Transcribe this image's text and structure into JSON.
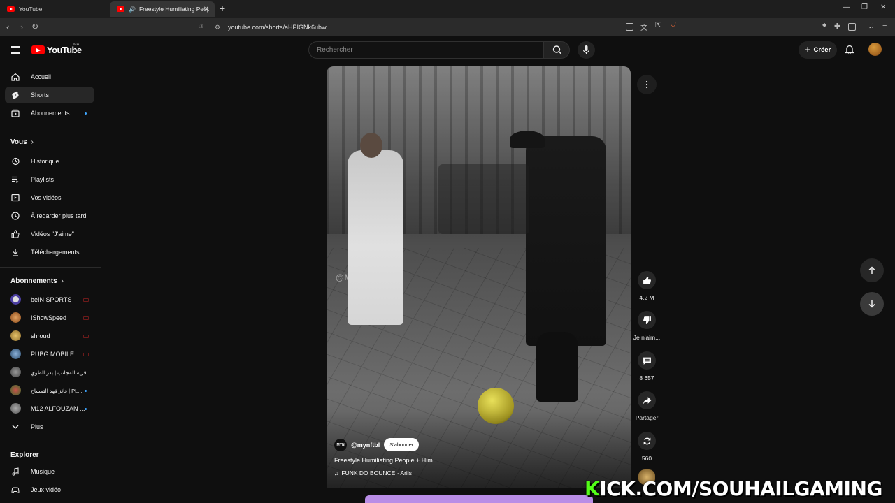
{
  "browser": {
    "tabs": [
      {
        "title": "YouTube"
      },
      {
        "title": "Freestyle Humiliating People"
      }
    ],
    "url": "youtube.com/shorts/aHPIGNk6ubw"
  },
  "header": {
    "logo_text": "YouTube",
    "country_code": "MA",
    "search_placeholder": "Rechercher",
    "create_label": "Créer"
  },
  "sidebar": {
    "main": [
      {
        "label": "Accueil",
        "icon": "home-icon"
      },
      {
        "label": "Shorts",
        "icon": "shorts-icon",
        "active": true
      },
      {
        "label": "Abonnements",
        "icon": "subscriptions-icon"
      }
    ],
    "you_heading": "Vous",
    "you": [
      {
        "label": "Historique",
        "icon": "history-icon"
      },
      {
        "label": "Playlists",
        "icon": "playlists-icon"
      },
      {
        "label": "Vos vidéos",
        "icon": "your-videos-icon"
      },
      {
        "label": "À regarder plus tard",
        "icon": "watch-later-icon"
      },
      {
        "label": "Vidéos \"J'aime\"",
        "icon": "liked-icon"
      },
      {
        "label": "Téléchargements",
        "icon": "downloads-icon"
      }
    ],
    "subs_heading": "Abonnements",
    "subscriptions": [
      {
        "label": "beIN SPORTS",
        "color": "#4b3ea0"
      },
      {
        "label": "IShowSpeed",
        "color": "#c9762a"
      },
      {
        "label": "shroud",
        "color": "#c9a24a"
      },
      {
        "label": "PUBG MOBILE",
        "color": "#3a5a8a"
      },
      {
        "label": "قرية المجانب | بدر الطوي",
        "color": "#666"
      },
      {
        "label": "فائز فهد التمساح | PL...",
        "color": "#4a7a3a"
      },
      {
        "label": "M12 ALFOUZAN ...",
        "color": "#777"
      }
    ],
    "more_label": "Plus",
    "explore_heading": "Explorer",
    "explore": [
      {
        "label": "Musique",
        "icon": "music-icon"
      },
      {
        "label": "Jeux vidéo",
        "icon": "gaming-icon"
      }
    ]
  },
  "short": {
    "watermark": "@MYNFTBL",
    "channel_avatar_text": "MYN",
    "channel": "@mynftbl",
    "subscribe_label": "S'abonner",
    "title": "Freestyle Humiliating People + Him",
    "music": "FUNK DO BOUNCE · Ariis"
  },
  "actions": {
    "likes": "4,2 M",
    "dislike_label": "Je n'aim...",
    "comments": "8 657",
    "share_label": "Partager",
    "remix_count": "560"
  },
  "overlay": {
    "kick_k": "K",
    "kick_rest": "ICK.COM/SOUHAILGAMING"
  },
  "colors": {
    "accent": "#ff0000",
    "background": "#0f0f0f",
    "kick_green": "#53fc18"
  }
}
